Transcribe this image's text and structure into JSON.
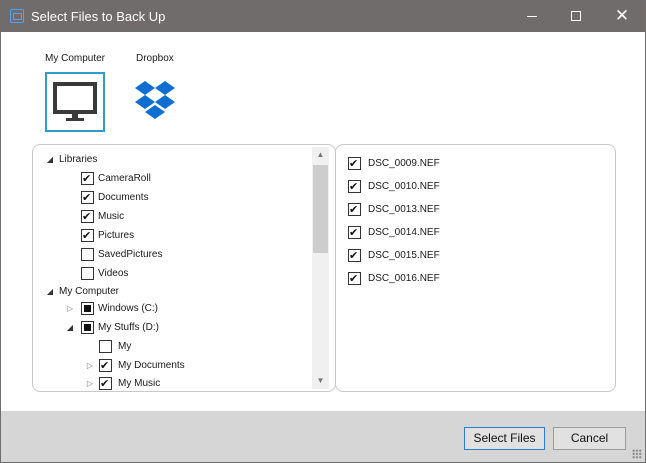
{
  "window": {
    "title": "Select Files to Back Up",
    "controls": {
      "minimize": "minimize",
      "maximize": "maximize",
      "close": "✕"
    }
  },
  "sources": [
    {
      "label": "My Computer",
      "icon": "monitor-icon",
      "selected": true
    },
    {
      "label": "Dropbox",
      "icon": "dropbox-icon",
      "selected": false
    }
  ],
  "tree": [
    {
      "label": "Libraries",
      "expander": "expanded",
      "checkbox": null
    },
    {
      "label": "CameraRoll",
      "expander": null,
      "checkbox": "checked"
    },
    {
      "label": "Documents",
      "expander": null,
      "checkbox": "checked"
    },
    {
      "label": "Music",
      "expander": null,
      "checkbox": "checked"
    },
    {
      "label": "Pictures",
      "expander": null,
      "checkbox": "checked"
    },
    {
      "label": "SavedPictures",
      "expander": null,
      "checkbox": "unchecked"
    },
    {
      "label": "Videos",
      "expander": null,
      "checkbox": "unchecked"
    },
    {
      "label": "My Computer",
      "expander": "expanded",
      "checkbox": null
    },
    {
      "label": "Windows (C:)",
      "expander": "collapsed",
      "checkbox": "partial"
    },
    {
      "label": "My Stuffs (D:)",
      "expander": "expanded",
      "checkbox": "partial"
    },
    {
      "label": "My",
      "expander": null,
      "checkbox": "unchecked"
    },
    {
      "label": "My Documents",
      "expander": "collapsed",
      "checkbox": "checked"
    },
    {
      "label": "My Music",
      "expander": "collapsed",
      "checkbox": "checked"
    }
  ],
  "files": [
    {
      "name": "DSC_0009.NEF",
      "checked": true
    },
    {
      "name": "DSC_0010.NEF",
      "checked": true
    },
    {
      "name": "DSC_0013.NEF",
      "checked": true
    },
    {
      "name": "DSC_0014.NEF",
      "checked": true
    },
    {
      "name": "DSC_0015.NEF",
      "checked": true
    },
    {
      "name": "DSC_0016.NEF",
      "checked": true
    }
  ],
  "footer": {
    "select_label": "Select Files",
    "cancel_label": "Cancel"
  },
  "colors": {
    "titlebar": "#6f6c6b",
    "selection_border": "#2f9ec7",
    "dropbox_blue": "#0f6ecf",
    "footer_bg": "#d6d6d6"
  }
}
